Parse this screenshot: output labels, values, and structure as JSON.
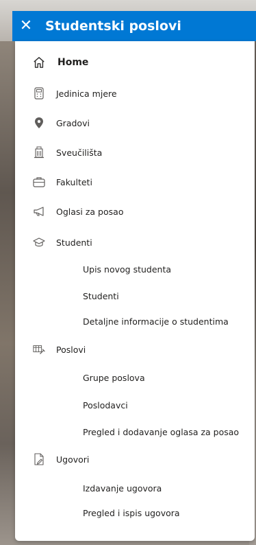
{
  "header": {
    "title": "Studentski poslovi",
    "close_icon": "close-icon",
    "accent": "#0078d4"
  },
  "nav": {
    "home": "Home",
    "jedinica_mjere": "Jedinica mjere",
    "gradovi": "Gradovi",
    "sveucilista": "Sveučilišta",
    "fakulteti": "Fakulteti",
    "oglasi": "Oglasi za posao",
    "studenti": "Studenti",
    "studenti_children": [
      "Upis novog studenta",
      "Studenti",
      "Detaljne informacije o studentima"
    ],
    "poslovi": "Poslovi",
    "poslovi_children": [
      "Grupe poslova",
      "Poslodavci",
      "Pregled i dodavanje oglasa za posao"
    ],
    "ugovori": "Ugovori",
    "ugovori_children": [
      "Izdavanje ugovora",
      "Pregled i ispis ugovora"
    ]
  }
}
